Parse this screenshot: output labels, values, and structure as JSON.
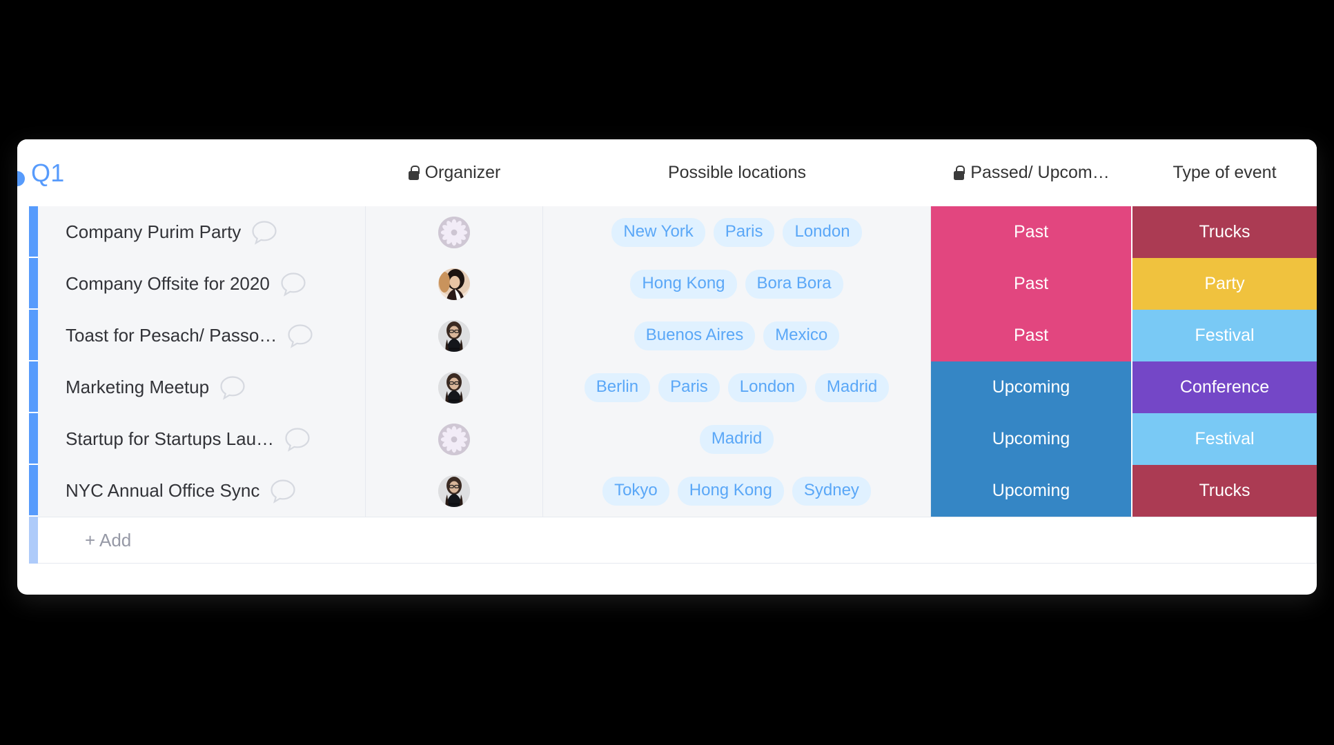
{
  "board": {
    "group_title": "Q1",
    "columns": [
      {
        "key": "name",
        "label": "",
        "locked": false
      },
      {
        "key": "organizer",
        "label": "Organizer",
        "locked": true
      },
      {
        "key": "locations",
        "label": "Possible locations",
        "locked": false
      },
      {
        "key": "status",
        "label": "Passed/ Upcom…",
        "locked": true
      },
      {
        "key": "type",
        "label": "Type of event",
        "locked": false
      }
    ],
    "add_label": "+ Add",
    "accent_color": "#579bfc",
    "tag_bg": "#e0f1ff",
    "tag_text": "#5aa7f7",
    "status_colors": {
      "Past": "#e2467f",
      "Upcoming": "#3586c5"
    },
    "type_colors": {
      "Trucks": "#ab3b53",
      "Party": "#f0c23e",
      "Festival": "#79c9f5",
      "Conference": "#7447c7"
    },
    "rows": [
      {
        "name": "Company Purim Party",
        "avatar": "flower-avatar",
        "locations": [
          "New York",
          "Paris",
          "London"
        ],
        "status": "Past",
        "type": "Trucks"
      },
      {
        "name": "Company Offsite for 2020",
        "avatar": "woman-long-hair-avatar",
        "locations": [
          "Hong Kong",
          "Bora Bora"
        ],
        "status": "Past",
        "type": "Party"
      },
      {
        "name": "Toast for Pesach/ Passo…",
        "avatar": "woman-glasses-avatar",
        "locations": [
          "Buenos Aires",
          "Mexico"
        ],
        "status": "Past",
        "type": "Festival"
      },
      {
        "name": "Marketing Meetup",
        "avatar": "woman-glasses-avatar",
        "locations": [
          "Berlin",
          "Paris",
          "London",
          "Madrid"
        ],
        "status": "Upcoming",
        "type": "Conference"
      },
      {
        "name": "Startup for Startups Lau…",
        "avatar": "flower-avatar",
        "locations": [
          "Madrid"
        ],
        "status": "Upcoming",
        "type": "Festival"
      },
      {
        "name": "NYC Annual Office Sync",
        "avatar": "woman-glasses-avatar",
        "locations": [
          "Tokyo",
          "Hong Kong",
          "Sydney"
        ],
        "status": "Upcoming",
        "type": "Trucks"
      }
    ]
  }
}
